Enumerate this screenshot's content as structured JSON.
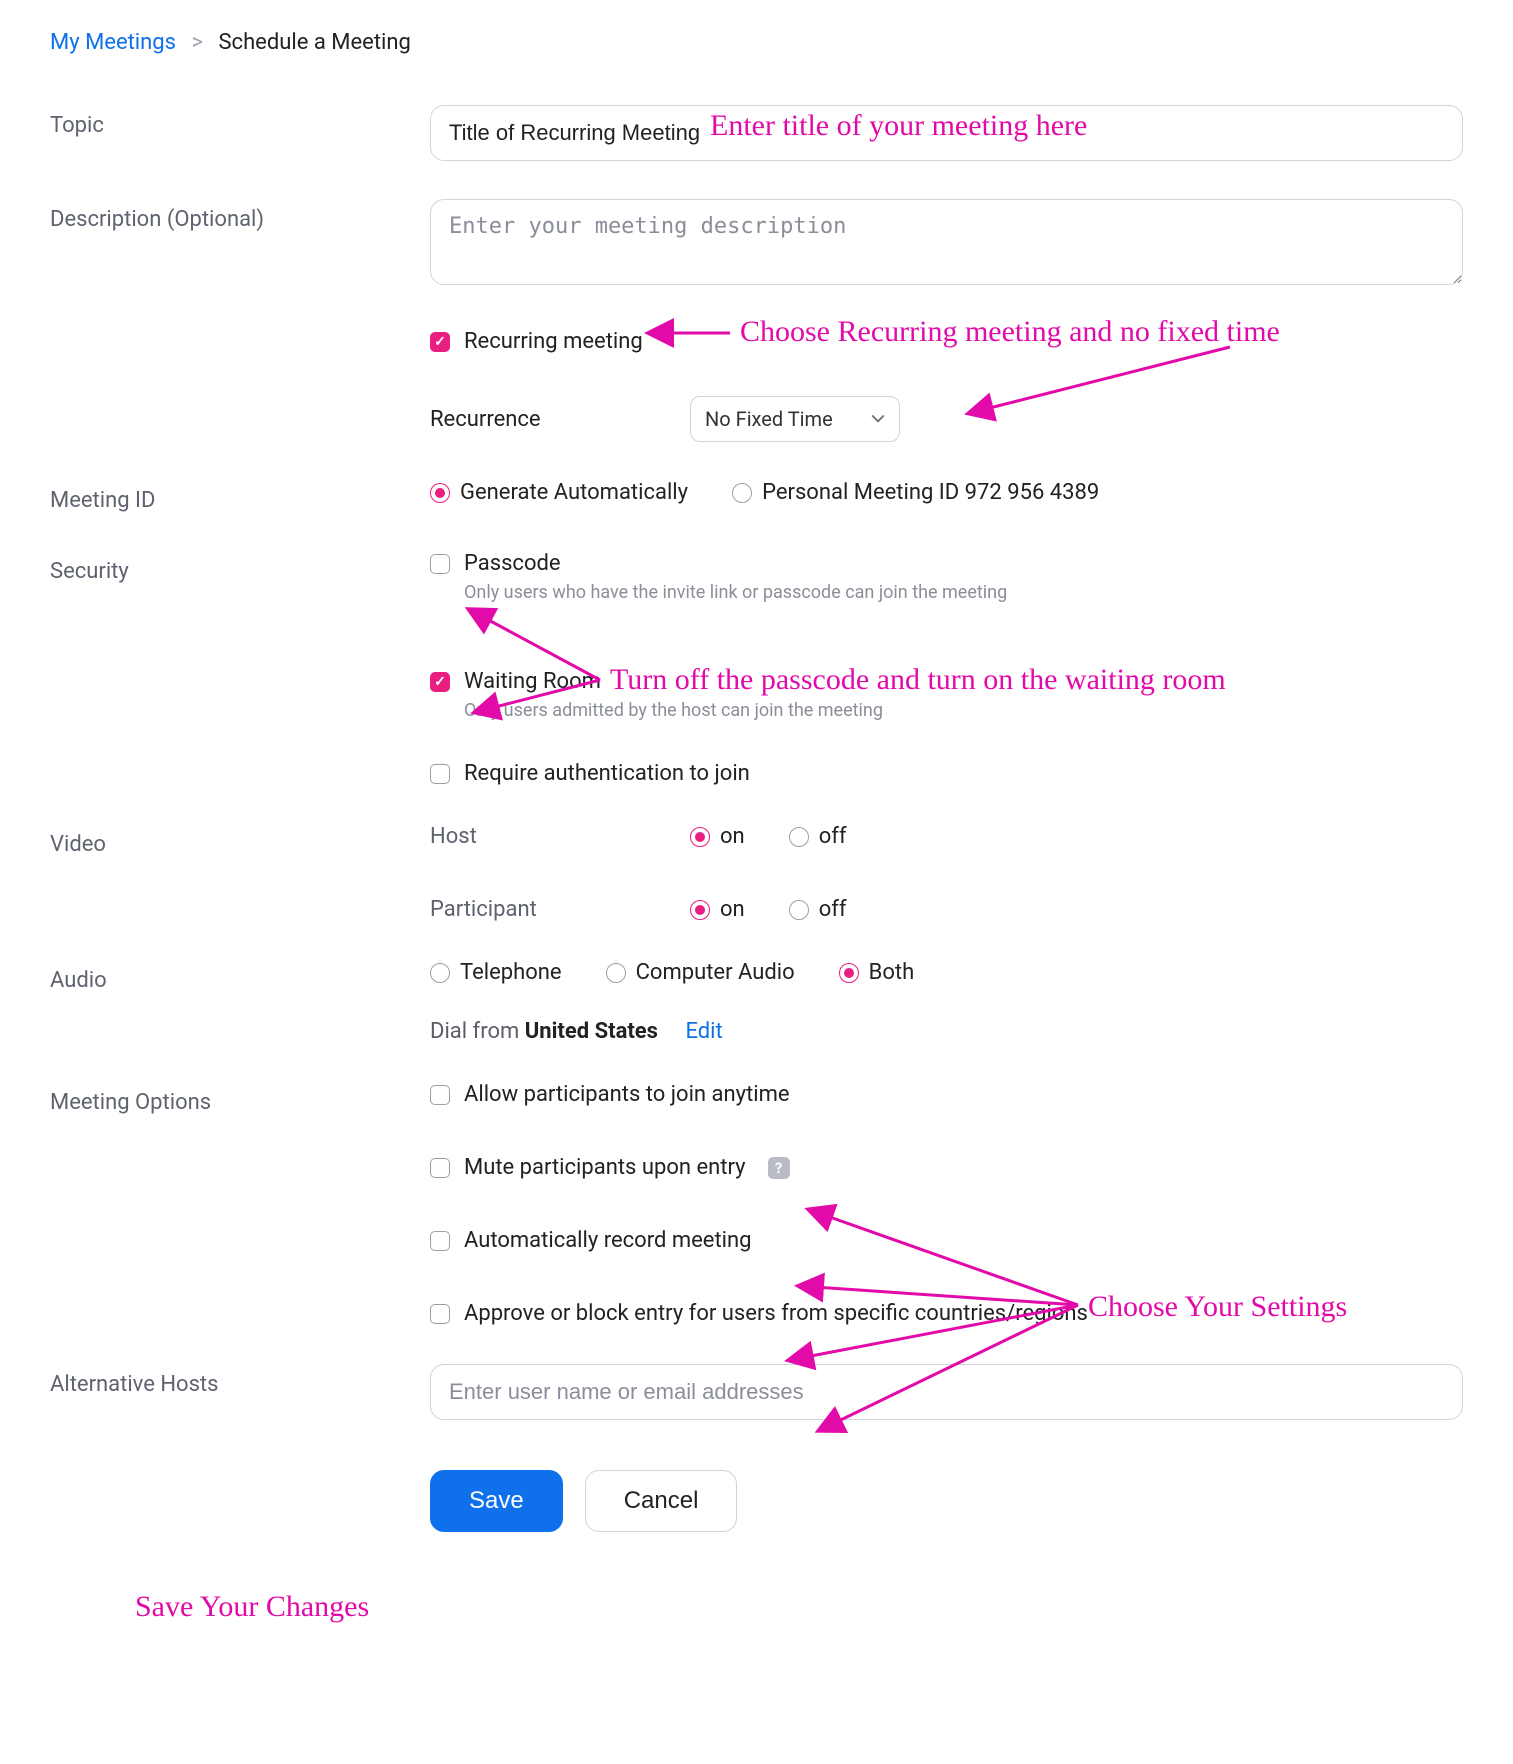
{
  "breadcrumb": {
    "meetings": "My Meetings",
    "schedule": "Schedule a Meeting"
  },
  "topic": {
    "label": "Topic",
    "value": "Title of Recurring Meeting"
  },
  "description": {
    "label": "Description (Optional)",
    "placeholder": "Enter your meeting description"
  },
  "recurring": {
    "label": "Recurring meeting",
    "recurrence_label": "Recurrence",
    "recurrence_value": "No Fixed Time"
  },
  "meeting_id": {
    "label": "Meeting ID",
    "generate": "Generate Automatically",
    "personal": "Personal Meeting ID 972 956 4389"
  },
  "security": {
    "label": "Security",
    "passcode": {
      "label": "Passcode",
      "hint": "Only users who have the invite link or passcode can join the meeting"
    },
    "waiting": {
      "label": "Waiting Room",
      "hint": "Only users admitted by the host can join the meeting"
    },
    "auth": {
      "label": "Require authentication to join"
    }
  },
  "video": {
    "label": "Video",
    "host": "Host",
    "participant": "Participant",
    "on": "on",
    "off": "off"
  },
  "audio": {
    "label": "Audio",
    "telephone": "Telephone",
    "computer": "Computer Audio",
    "both": "Both",
    "dial_prefix": "Dial from ",
    "dial_country": "United States",
    "edit": "Edit"
  },
  "options": {
    "label": "Meeting Options",
    "anytime": "Allow participants to join anytime",
    "mute": "Mute participants upon entry",
    "record": "Automatically record meeting",
    "geo": "Approve or block entry for users from specific countries/regions"
  },
  "alt_hosts": {
    "label": "Alternative Hosts",
    "placeholder": "Enter user name or email addresses"
  },
  "buttons": {
    "save": "Save",
    "cancel": "Cancel"
  },
  "annotations": {
    "title_hint": "Enter title of your meeting here",
    "recurring_hint": "Choose Recurring meeting and no fixed time",
    "security_hint": "Turn off the passcode and turn on the waiting room",
    "settings_hint": "Choose Your Settings",
    "save_hint": "Save Your Changes"
  }
}
